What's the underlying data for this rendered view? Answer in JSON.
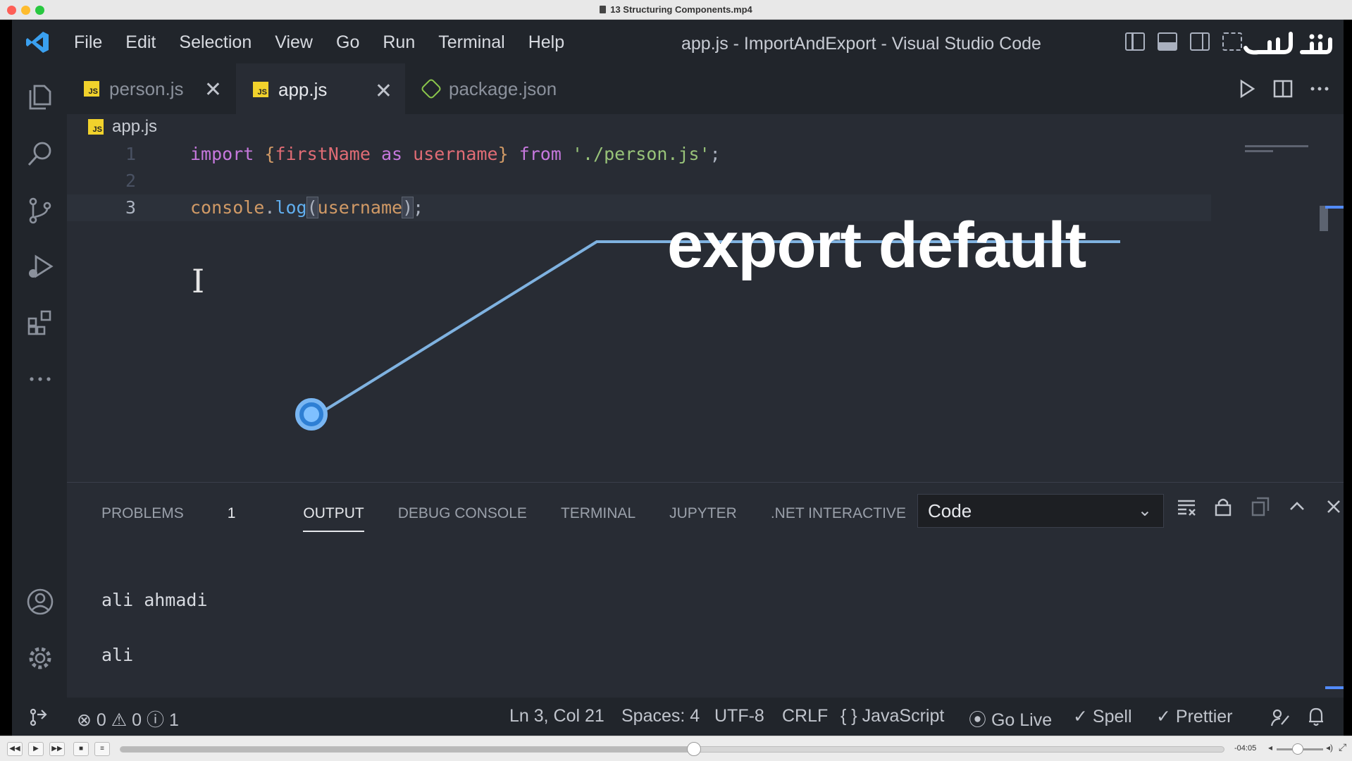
{
  "mac": {
    "window_title": "13 Structuring Components.mp4"
  },
  "titlebar": {
    "menu": [
      "File",
      "Edit",
      "Selection",
      "View",
      "Go",
      "Run",
      "Terminal",
      "Help"
    ],
    "title": "app.js - ImportAndExport - Visual Studio Code",
    "brand_logo": "کلاسیک"
  },
  "tabs": [
    {
      "label": "person.js",
      "icon": "js-file-icon",
      "close": "✕"
    },
    {
      "label": "app.js",
      "icon": "js-file-icon",
      "close": "✕",
      "active": true
    },
    {
      "label": "package.json",
      "icon": "nodejs-icon"
    }
  ],
  "breadcrumb": {
    "file": "app.js"
  },
  "editor": {
    "lines": [
      {
        "n": "1",
        "tokens": [
          "import",
          " ",
          "{",
          "firstName",
          " ",
          "as",
          " ",
          "username",
          "}",
          " ",
          "from",
          " ",
          "'./person.js'",
          ";"
        ]
      },
      {
        "n": "2"
      },
      {
        "n": "3",
        "tokens": [
          "console",
          ".",
          "log",
          "(",
          "username",
          ")",
          ";"
        ]
      }
    ]
  },
  "overlay": {
    "title": "export default"
  },
  "panel": {
    "tabs": [
      "PROBLEMS",
      "OUTPUT",
      "DEBUG CONSOLE",
      "TERMINAL",
      "JUPYTER",
      ".NET INTERACTIVE"
    ],
    "problems_count": "1",
    "active_tab": "OUTPUT",
    "dropdown_value": "Code",
    "output_lines": [
      "ali ahmadi",
      "ali"
    ]
  },
  "statusbar": {
    "errors": "0",
    "warnings": "0",
    "infos": "1",
    "position": "Ln 3, Col 21",
    "spaces": "Spaces: 4",
    "encoding": "UTF-8",
    "eol": "CRLF",
    "language": "JavaScript",
    "go_live": "Go Live",
    "spell": "Spell",
    "prettier": "Prettier"
  },
  "player": {
    "time": "-04:05",
    "progress": 0.52
  },
  "colors": {
    "accent": "#528bff",
    "js_badge": "#f1d22c",
    "keyword": "#c678dd",
    "variable": "#e06c75",
    "string": "#98c379",
    "function": "#61afef"
  }
}
